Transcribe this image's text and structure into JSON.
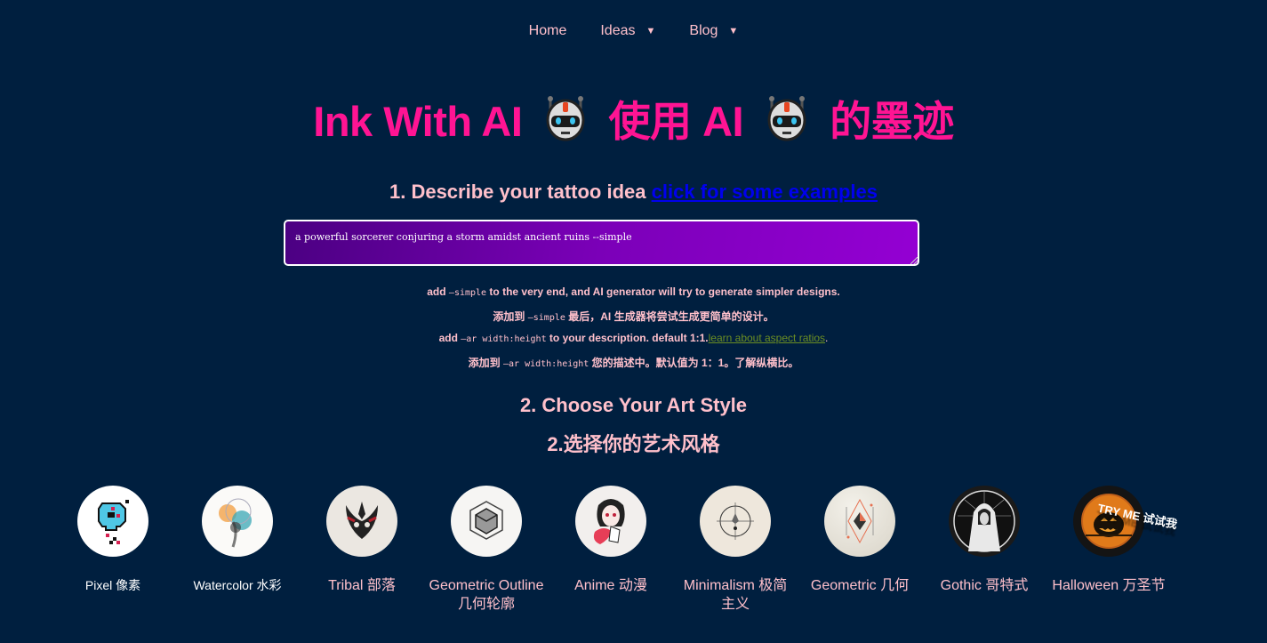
{
  "nav": {
    "items": [
      {
        "label": "Home",
        "has_dropdown": false
      },
      {
        "label": "Ideas",
        "has_dropdown": true
      },
      {
        "label": "Blog",
        "has_dropdown": true
      }
    ],
    "caret": "▼"
  },
  "header": {
    "title_part1": "Ink With AI",
    "title_part2": "使用 AI",
    "title_part3": "的墨迹",
    "icon": "robot-icon"
  },
  "step1": {
    "heading": "1. Describe your tattoo idea",
    "examples_link": "click for some examples",
    "prompt_value": "a powerful sorcerer conjuring a storm amidst ancient ruins --simple"
  },
  "hints": {
    "simple_en_pre": "add ",
    "simple_code": "—simple",
    "simple_en_post": " to the very end, and AI generator will try to generate simpler designs.",
    "simple_zh_pre": "添加到 ",
    "simple_zh_code": "—simple",
    "simple_zh_post": " 最后，AI 生成器将尝试生成更简单的设计。",
    "ar_en_pre": "add ",
    "ar_code": "—ar width:height",
    "ar_en_post": " to your description. default 1:1.",
    "ar_link": "learn about aspect ratios",
    "ar_en_end": ".",
    "ar_zh_pre": "添加到 ",
    "ar_zh_code": "—ar width:height",
    "ar_zh_post": " 您的描述中。默认值为 1：1。了解纵横比。"
  },
  "step2": {
    "heading_en": "2. Choose Your Art Style",
    "heading_zh": "2.选择你的艺术风格"
  },
  "styles": [
    {
      "label": "Pixel 像素"
    },
    {
      "label": "Watercolor 水彩"
    },
    {
      "label": "Tribal 部落"
    },
    {
      "label": "Geometric Outline 几何轮廓"
    },
    {
      "label": "Anime 动漫"
    },
    {
      "label": "Minimalism 极简 主义"
    },
    {
      "label": "Geometric 几何"
    },
    {
      "label": "Gothic 哥特式"
    },
    {
      "label": "Halloween 万圣节"
    }
  ],
  "badge": {
    "try_me": "TRY ME 试试我"
  },
  "colors": {
    "background": "#001f3f",
    "title": "#ff1493",
    "text": "#ffc0cb",
    "link": "#0000ee",
    "aspect_link": "#6b8e23"
  }
}
